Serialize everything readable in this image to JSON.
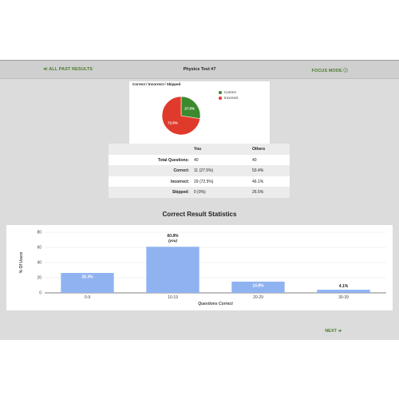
{
  "topbar": {
    "back_label": "≪ ALL PAST RESULTS",
    "title": "Physics Test #7",
    "focus_label": "FOCUS MODE ⓘ"
  },
  "pie": {
    "title": "Correct / Incorrect / Skipped",
    "slices": [
      {
        "name": "Correct",
        "value": 27.5,
        "label": "27.5%",
        "color": "#3b8a2e"
      },
      {
        "name": "Incorrect",
        "value": 72.5,
        "label": "72.5%",
        "color": "#e03a2c"
      }
    ]
  },
  "stats": {
    "headers": {
      "label": "",
      "you": "You",
      "others": "Others"
    },
    "rows": [
      {
        "label": "Total Questions:",
        "you": "40",
        "others": "40"
      },
      {
        "label": "Correct:",
        "you": "11 (27.5%)",
        "others": "53.4%"
      },
      {
        "label": "Incorrect:",
        "you": "29 (72.5%)",
        "others": "46.1%"
      },
      {
        "label": "Skipped:",
        "you": "0 (0%)",
        "others": "26.5%"
      }
    ]
  },
  "section_title": "Correct Result Statistics",
  "chart_data": {
    "type": "bar",
    "categories": [
      "0-9",
      "10-19",
      "20-29",
      "30-39"
    ],
    "values": [
      26.3,
      60.8,
      14.8,
      4.1
    ],
    "data_labels": [
      "26.3%",
      "60.8%",
      "14.8%",
      "4.1%"
    ],
    "highlight_note": "(you)",
    "highlight_index": 1,
    "xlabel": "Questions Correct",
    "ylabel": "% Of Users",
    "ylim": [
      0,
      80
    ],
    "yticks": [
      0,
      20,
      40,
      60,
      80
    ],
    "grid": true,
    "bar_color": "#8fb3f0"
  },
  "footer": {
    "next_label": "NEXT ➔"
  }
}
